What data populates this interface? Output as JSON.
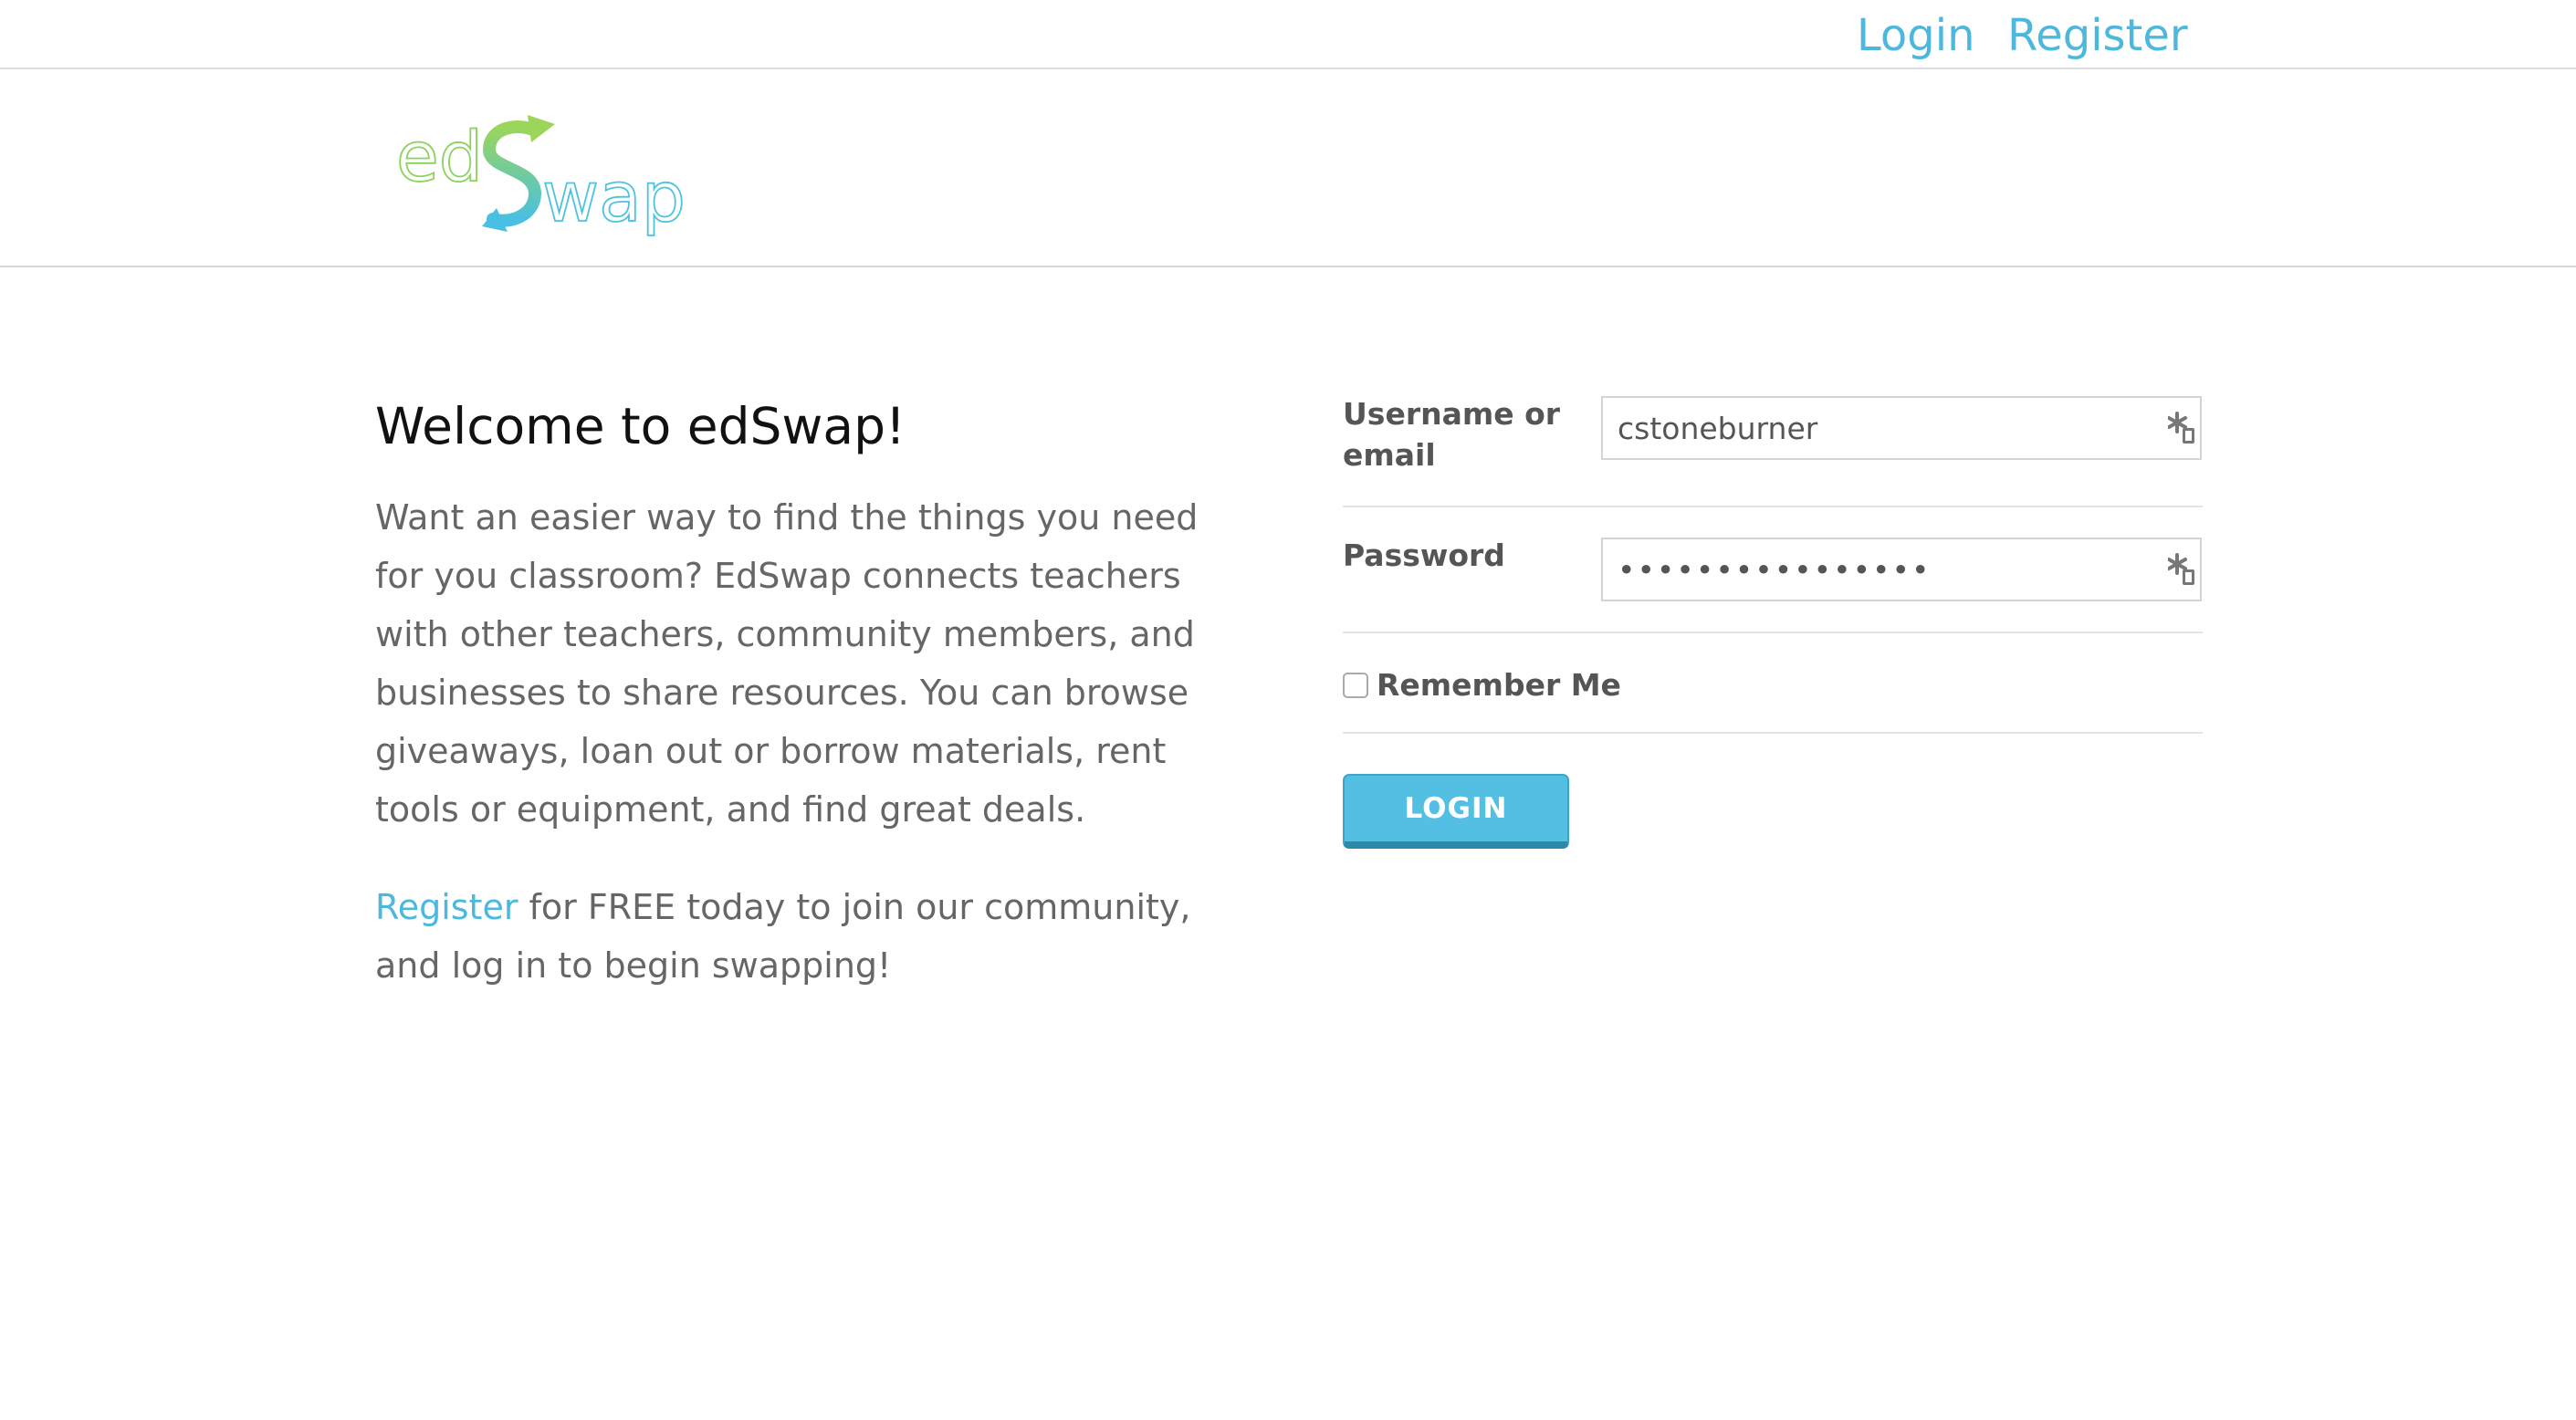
{
  "topnav": {
    "login": "Login",
    "register": "Register",
    "link_color": "#4db8dd"
  },
  "brand": {
    "logo_text": "edSwap",
    "logo_part_ed": "ed",
    "logo_part_s": "S",
    "logo_part_wap": "wap",
    "color_green": "#8dd15f",
    "color_blue": "#4dc3e0"
  },
  "welcome": {
    "title": "Welcome to edSwap!",
    "intro": "Want an easier way to find the things you need for you classroom? EdSwap connects teachers with other teachers, community members, and businesses to share resources. You can browse giveaways, loan out or borrow materials, rent tools or equipment, and find great deals.",
    "cta_link": "Register",
    "cta_text": " for FREE today to join our community, and log in to begin swapping!"
  },
  "login_form": {
    "username_label": "Username or email",
    "username_value": "cstoneburner",
    "password_label": "Password",
    "password_value": "••••••••••••••••",
    "remember_label": "Remember Me",
    "remember_checked": false,
    "submit_label": "LOGIN",
    "field_icon": "password-manager-icon",
    "button_color": "#52bfe3"
  }
}
